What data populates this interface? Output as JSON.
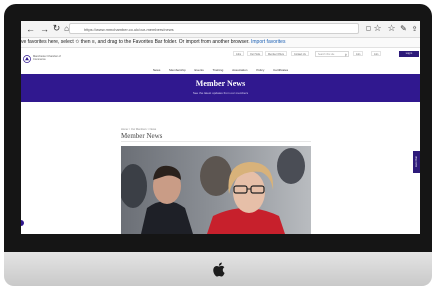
{
  "browser": {
    "url": "https://www.mmchamber.co.uk/our-members/news",
    "favorites_hint": "ve favorites here, select  ✩  then ≡, and drag to the Favorites Bar folder. Or import from another browser.",
    "import_link": "Import favorites"
  },
  "site": {
    "logo_text": "Manchester Chamber of Commerce",
    "utility_links": [
      "Jobs",
      "Our Hubs",
      "Member Offers",
      "Contact Us"
    ],
    "search_placeholder": "Search this site",
    "join_label": "Join",
    "login_label": "Log in",
    "nav": [
      "News",
      "Membership",
      "Events",
      "Training",
      "Association",
      "Policy",
      "Certificates"
    ],
    "banner": {
      "title": "Member News",
      "subtitle": "See the latest updates from our members"
    },
    "breadcrumb": "Home > Our Members > News",
    "page_title": "Member News",
    "chat_label": "Live Chat"
  },
  "colors": {
    "brand_purple": "#30188f",
    "bezel": "#151515"
  }
}
